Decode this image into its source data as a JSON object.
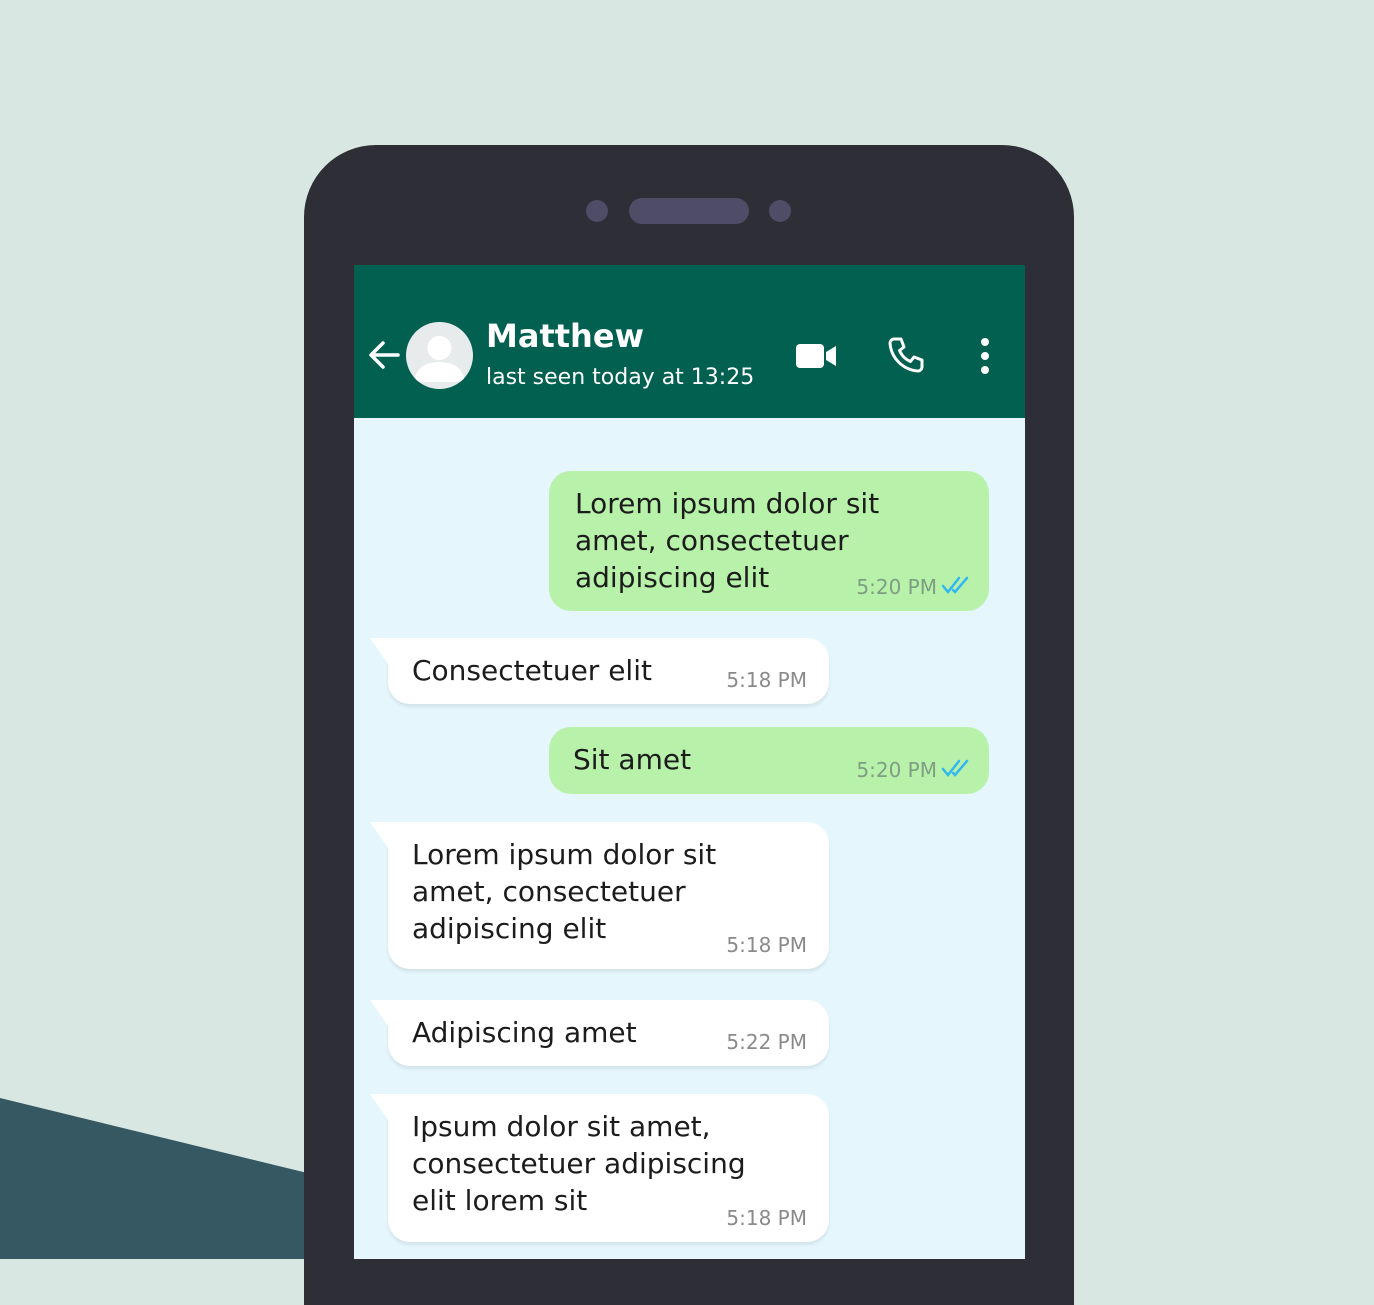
{
  "header": {
    "contact_name": "Matthew",
    "status": "last seen today at 13:25"
  },
  "messages": [
    {
      "direction": "outgoing",
      "text": "Lorem ipsum dolor sit\namet, consectetuer\nadipiscing elit",
      "time": "5:20 PM",
      "read": true
    },
    {
      "direction": "incoming",
      "text": "Consectetuer elit",
      "time": "5:18 PM"
    },
    {
      "direction": "outgoing",
      "text": "Sit amet",
      "time": "5:20 PM",
      "read": true
    },
    {
      "direction": "incoming",
      "text": "Lorem ipsum dolor sit\namet, consectetuer\nadipiscing elit",
      "time": "5:18 PM"
    },
    {
      "direction": "incoming",
      "text": "Adipiscing amet",
      "time": "5:22 PM"
    },
    {
      "direction": "incoming",
      "text": "Ipsum dolor sit amet,\nconsectetuer adipiscing\nelit lorem sit",
      "time": "5:18 PM"
    }
  ],
  "colors": {
    "header": "#01604f",
    "outgoing_bubble": "#b8f2aa",
    "incoming_bubble": "#ffffff",
    "chat_background": "#e5f6fd",
    "read_ticks": "#34b7f1"
  },
  "icons": [
    "back-arrow-icon",
    "avatar-icon",
    "video-camera-icon",
    "phone-icon",
    "more-vertical-icon",
    "double-check-icon"
  ]
}
